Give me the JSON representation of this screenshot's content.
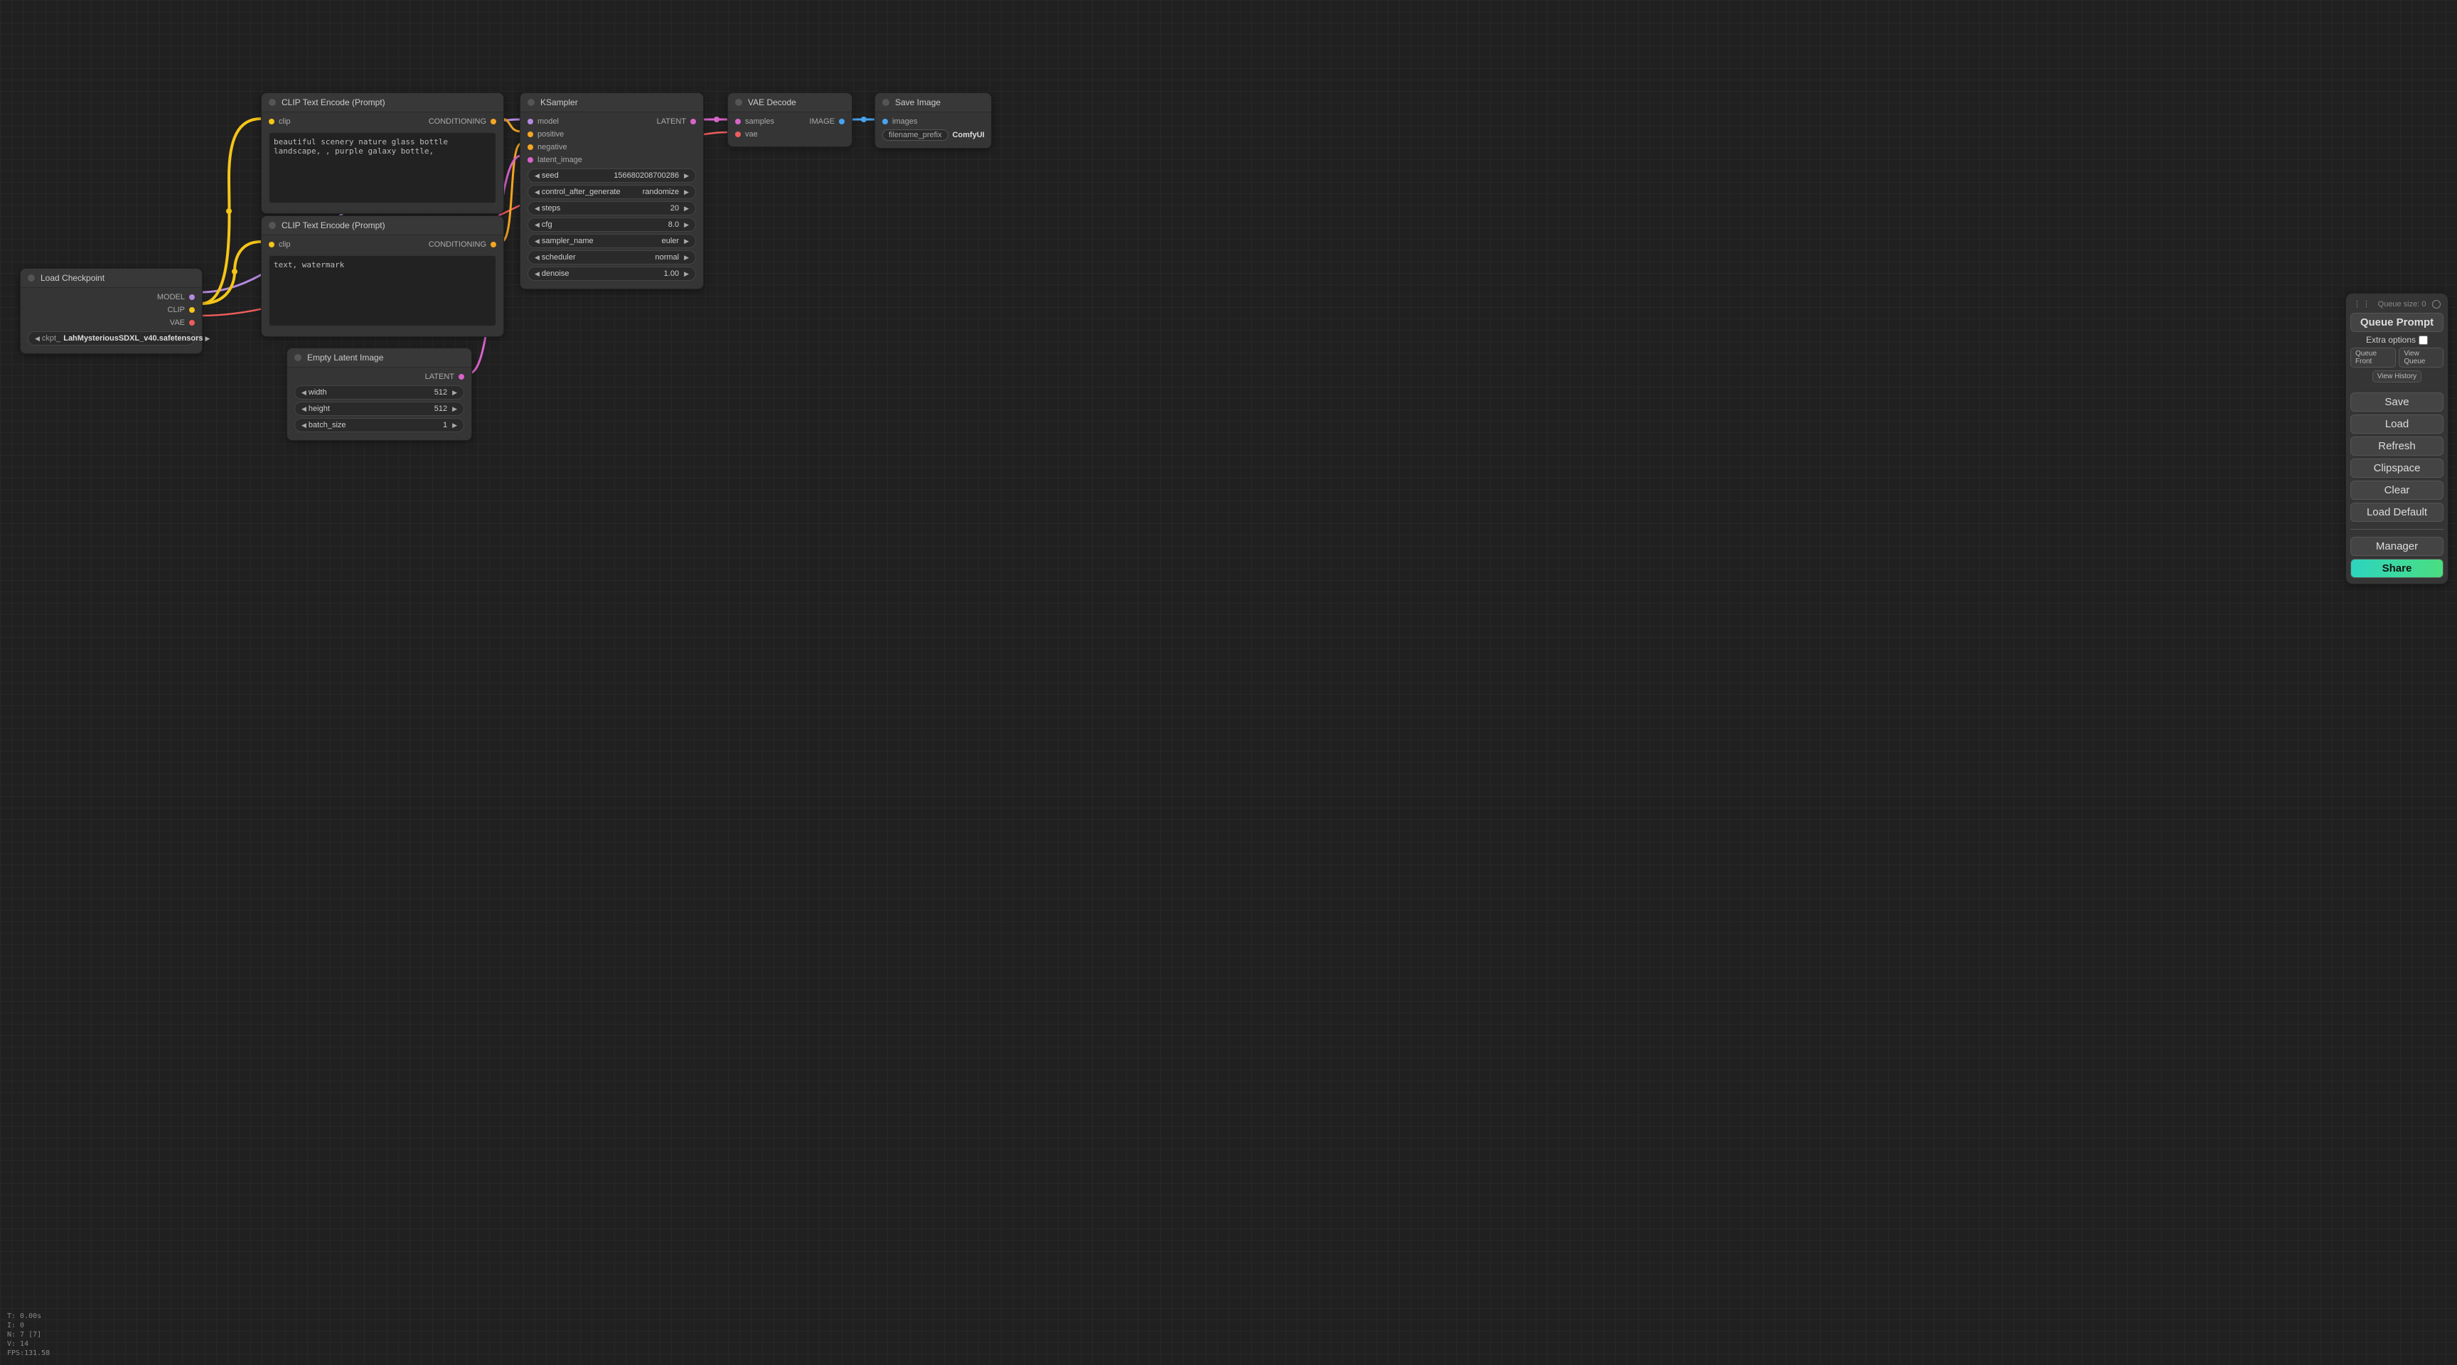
{
  "nodes": {
    "load_checkpoint": {
      "title": "Load Checkpoint",
      "outputs": {
        "model": "MODEL",
        "clip": "CLIP",
        "vae": "VAE"
      },
      "ckpt_prefix": "ckpt_",
      "ckpt_value": "LahMysteriousSDXL_v40.safetensors"
    },
    "clip_pos": {
      "title": "CLIP Text Encode (Prompt)",
      "input": "clip",
      "output": "CONDITIONING",
      "text": "beautiful scenery nature glass bottle landscape, , purple galaxy bottle,"
    },
    "clip_neg": {
      "title": "CLIP Text Encode (Prompt)",
      "input": "clip",
      "output": "CONDITIONING",
      "text": "text, watermark"
    },
    "empty_latent": {
      "title": "Empty Latent Image",
      "output": "LATENT",
      "width_label": "width",
      "width_value": "512",
      "height_label": "height",
      "height_value": "512",
      "batch_label": "batch_size",
      "batch_value": "1"
    },
    "ksampler": {
      "title": "KSampler",
      "inputs": {
        "model": "model",
        "positive": "positive",
        "negative": "negative",
        "latent": "latent_image"
      },
      "output": "LATENT",
      "params": {
        "seed_label": "seed",
        "seed_value": "156680208700286",
        "cag_label": "control_after_generate",
        "cag_value": "randomize",
        "steps_label": "steps",
        "steps_value": "20",
        "cfg_label": "cfg",
        "cfg_value": "8.0",
        "sampler_label": "sampler_name",
        "sampler_value": "euler",
        "sched_label": "scheduler",
        "sched_value": "normal",
        "denoise_label": "denoise",
        "denoise_value": "1.00"
      }
    },
    "vae_decode": {
      "title": "VAE Decode",
      "inputs": {
        "samples": "samples",
        "vae": "vae"
      },
      "output": "IMAGE"
    },
    "save_image": {
      "title": "Save Image",
      "input": "images",
      "prefix_label": "filename_prefix",
      "prefix_value": "ComfyUI"
    }
  },
  "panel": {
    "queue_size": "Queue size: 0",
    "queue_prompt": "Queue Prompt",
    "extra_options": "Extra options",
    "queue_front": "Queue Front",
    "view_queue": "View Queue",
    "view_history": "View History",
    "save": "Save",
    "load": "Load",
    "refresh": "Refresh",
    "clipspace": "Clipspace",
    "clear": "Clear",
    "load_default": "Load Default",
    "manager": "Manager",
    "share": "Share"
  },
  "stats": "T: 0.00s\nI: 0\nN: 7 [7]\nV: 14\nFPS:131.58"
}
